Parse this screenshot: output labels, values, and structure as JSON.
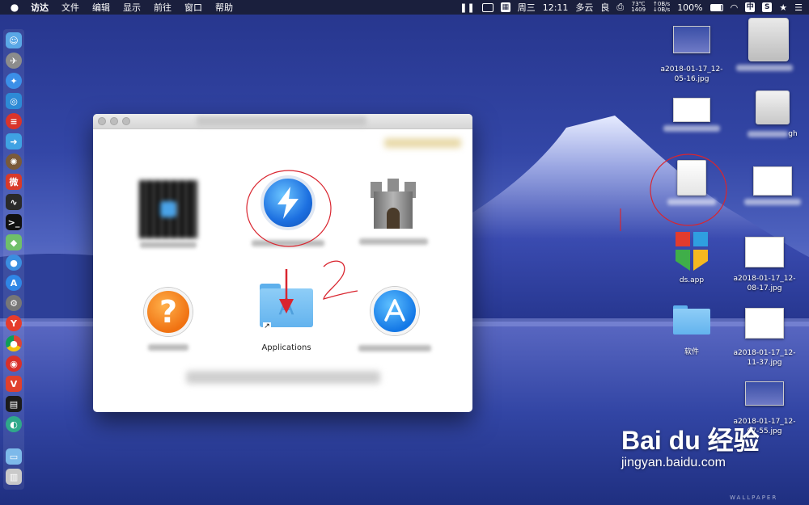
{
  "menubar": {
    "apple": "",
    "items": [
      "访达",
      "文件",
      "编辑",
      "显示",
      "前往",
      "窗口",
      "帮助"
    ],
    "day": "周三",
    "time": "12:11",
    "weather": "多云",
    "air": "良",
    "temp": "73℃",
    "fan": "1409",
    "net_up": "↑0B/s",
    "net_down": "↓0B/s",
    "battery": "100%",
    "input": "中"
  },
  "window": {
    "items": {
      "applications": "Applications"
    },
    "help_glyph": "?"
  },
  "desktop": {
    "file1_label": "a2018-01-17_12-05-16.jpg",
    "ds_label": "ds.app",
    "file2_label": "a2018-01-17_12-08-17.jpg",
    "folder_label": "软件",
    "file3_label": "a2018-01-17_12-11-37.jpg",
    "file4_label": "a2018-01-17_12-07-55.jpg",
    "gh_fragment": "gh"
  },
  "annotation": {
    "step_number": "2"
  },
  "watermark": {
    "brand": "Bai du 经验",
    "site": "jingyan.baidu.com",
    "wallpaper": "WALLPAPER"
  },
  "colors": {
    "annotation_red": "#d9252f",
    "menubar_bg": "#1a1f3d",
    "desktop_top": "#26358c"
  }
}
